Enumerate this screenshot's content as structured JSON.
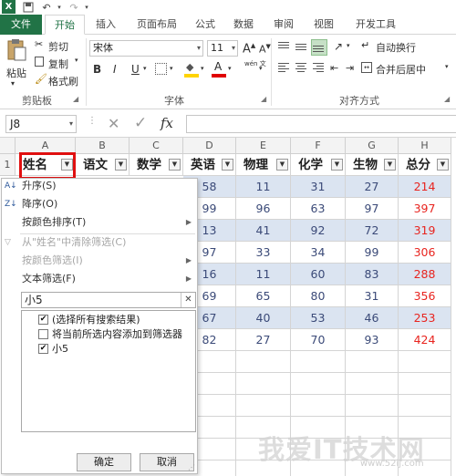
{
  "title_bar": {
    "logo": "X",
    "icons": [
      "save-icon",
      "undo-icon",
      "redo-icon",
      "customize-icon"
    ]
  },
  "tabs": [
    "文件",
    "开始",
    "插入",
    "页面布局",
    "公式",
    "数据",
    "审阅",
    "视图",
    "开发工具"
  ],
  "ribbon": {
    "clipboard": {
      "paste": "粘贴",
      "cut": "剪切",
      "copy": "复制",
      "format_painter": "格式刷",
      "label": "剪贴板"
    },
    "font": {
      "font_name": "宋体",
      "font_size": "11",
      "bold": "B",
      "italic": "I",
      "underline": "U",
      "grow": "A",
      "shrink": "A",
      "label": "字体",
      "wen": "wén 文"
    },
    "alignment": {
      "wrap": "自动换行",
      "merge": "合并后居中",
      "label": "对齐方式"
    }
  },
  "formula_bar": {
    "name_box": "J8",
    "cancel": "✕",
    "enter": "✓",
    "fx": "fx",
    "content": ""
  },
  "columns": [
    "A",
    "B",
    "C",
    "D",
    "E",
    "F",
    "G",
    "H"
  ],
  "row1_number": "1",
  "headers": [
    "姓名",
    "语文",
    "数学",
    "英语",
    "物理",
    "化学",
    "生物",
    "总分"
  ],
  "data_rows": [
    {
      "d": "58",
      "e": "11",
      "f": "31",
      "g": "27",
      "h": "214"
    },
    {
      "d": "99",
      "e": "96",
      "f": "63",
      "g": "97",
      "h": "397"
    },
    {
      "d": "13",
      "e": "41",
      "f": "92",
      "g": "72",
      "h": "319"
    },
    {
      "d": "97",
      "e": "33",
      "f": "34",
      "g": "99",
      "h": "306"
    },
    {
      "d": "16",
      "e": "11",
      "f": "60",
      "g": "83",
      "h": "288"
    },
    {
      "d": "69",
      "e": "65",
      "f": "80",
      "g": "31",
      "h": "356"
    },
    {
      "d": "67",
      "e": "40",
      "f": "53",
      "g": "46",
      "h": "253"
    },
    {
      "d": "82",
      "e": "27",
      "f": "70",
      "g": "93",
      "h": "424"
    }
  ],
  "filter_menu": {
    "sort_asc": "升序(S)",
    "sort_desc": "降序(O)",
    "sort_by_color": "按颜色排序(T)",
    "clear_filter": "从\"姓名\"中清除筛选(C)",
    "filter_by_color": "按颜色筛选(I)",
    "text_filter": "文本筛选(F)",
    "search_value": "小5",
    "clear_search": "✕",
    "list": [
      {
        "label": "(选择所有搜索结果)",
        "checked": true
      },
      {
        "label": "将当前所选内容添加到筛选器",
        "checked": false
      },
      {
        "label": "小5",
        "checked": true
      }
    ],
    "ok": "确定",
    "cancel": "取消"
  },
  "watermark": {
    "main": "我爱IT技术网",
    "sub": "www.52ij.com"
  },
  "colors": {
    "excel_green": "#217346",
    "band": "#dbe4f1",
    "total_red": "#e8241f",
    "annotation_red": "#e01010"
  }
}
